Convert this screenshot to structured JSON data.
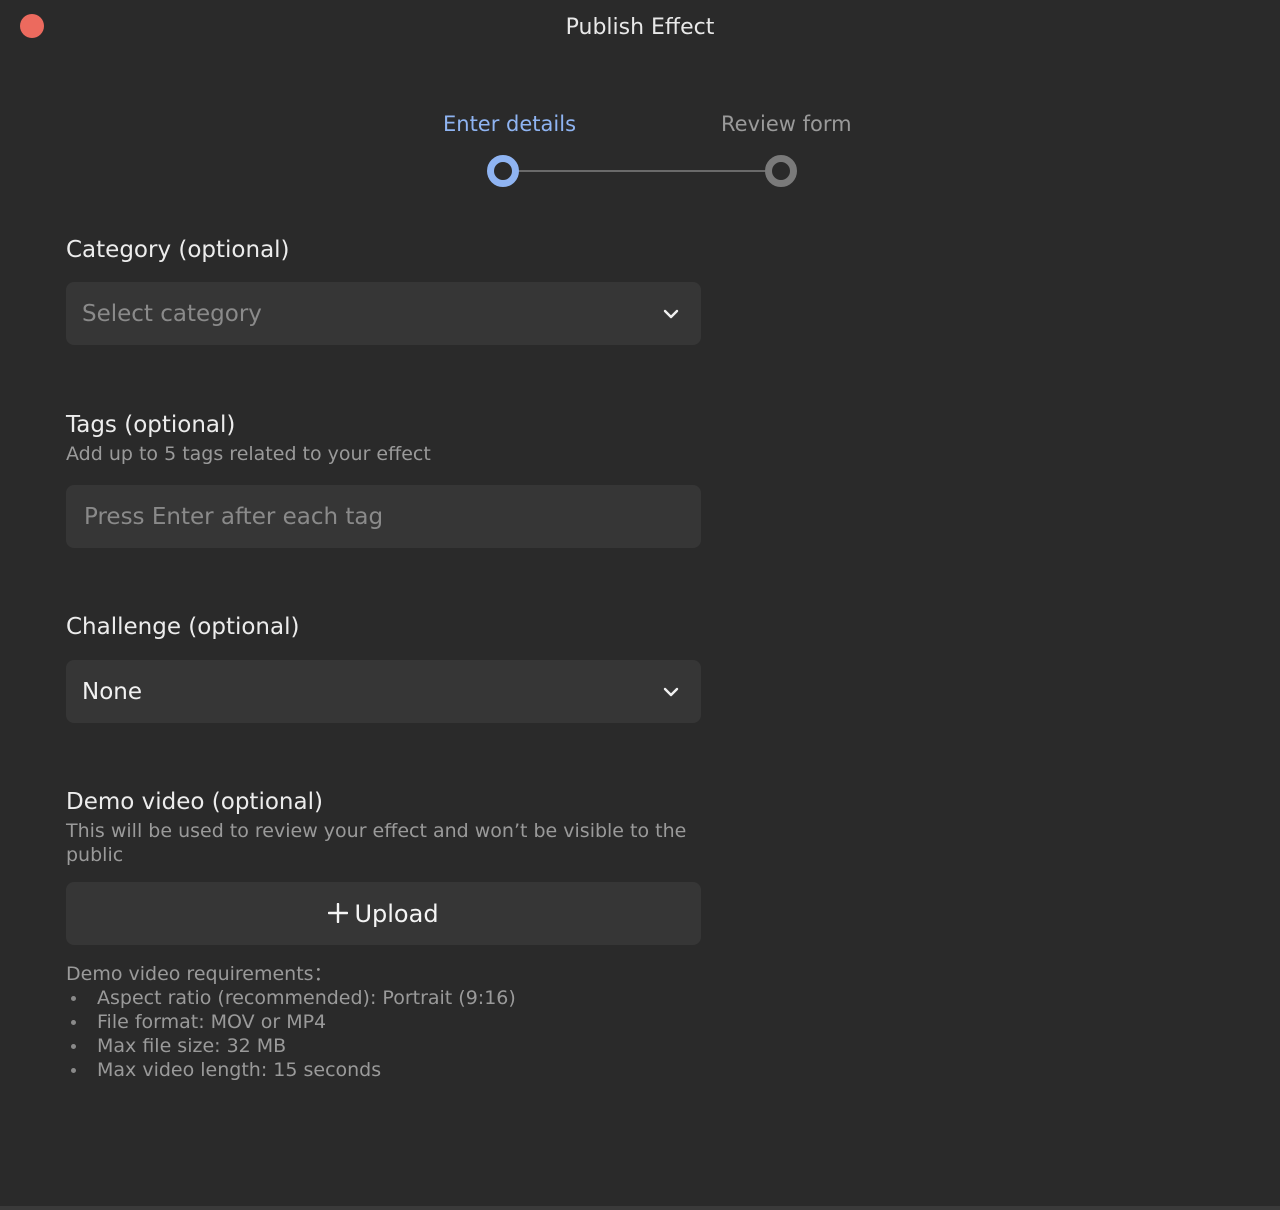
{
  "window": {
    "title": "Publish Effect"
  },
  "stepper": {
    "steps": [
      {
        "label": "Enter details",
        "state": "active"
      },
      {
        "label": "Review form",
        "state": "inactive"
      }
    ]
  },
  "form": {
    "category": {
      "label": "Category (optional)",
      "placeholder": "Select category"
    },
    "tags": {
      "label": "Tags (optional)",
      "help": "Add up to 5 tags related to your effect",
      "placeholder": "Press Enter after each tag"
    },
    "challenge": {
      "label": "Challenge (optional)",
      "value": "None"
    },
    "demo_video": {
      "label": "Demo video (optional)",
      "help": "This will be used to review your effect and won’t be visible to the public",
      "upload_label": "Upload",
      "requirements_title": "Demo video requirements：",
      "requirements": [
        "Aspect ratio (recommended): Portrait (9:16)",
        "File format: MOV or MP4",
        "Max file size: 32 MB",
        "Max video length: 15 seconds"
      ]
    }
  },
  "colors": {
    "background": "#2a2a2a",
    "field": "#363636",
    "accent": "#8fb4f2",
    "close": "#ec6a5e"
  }
}
